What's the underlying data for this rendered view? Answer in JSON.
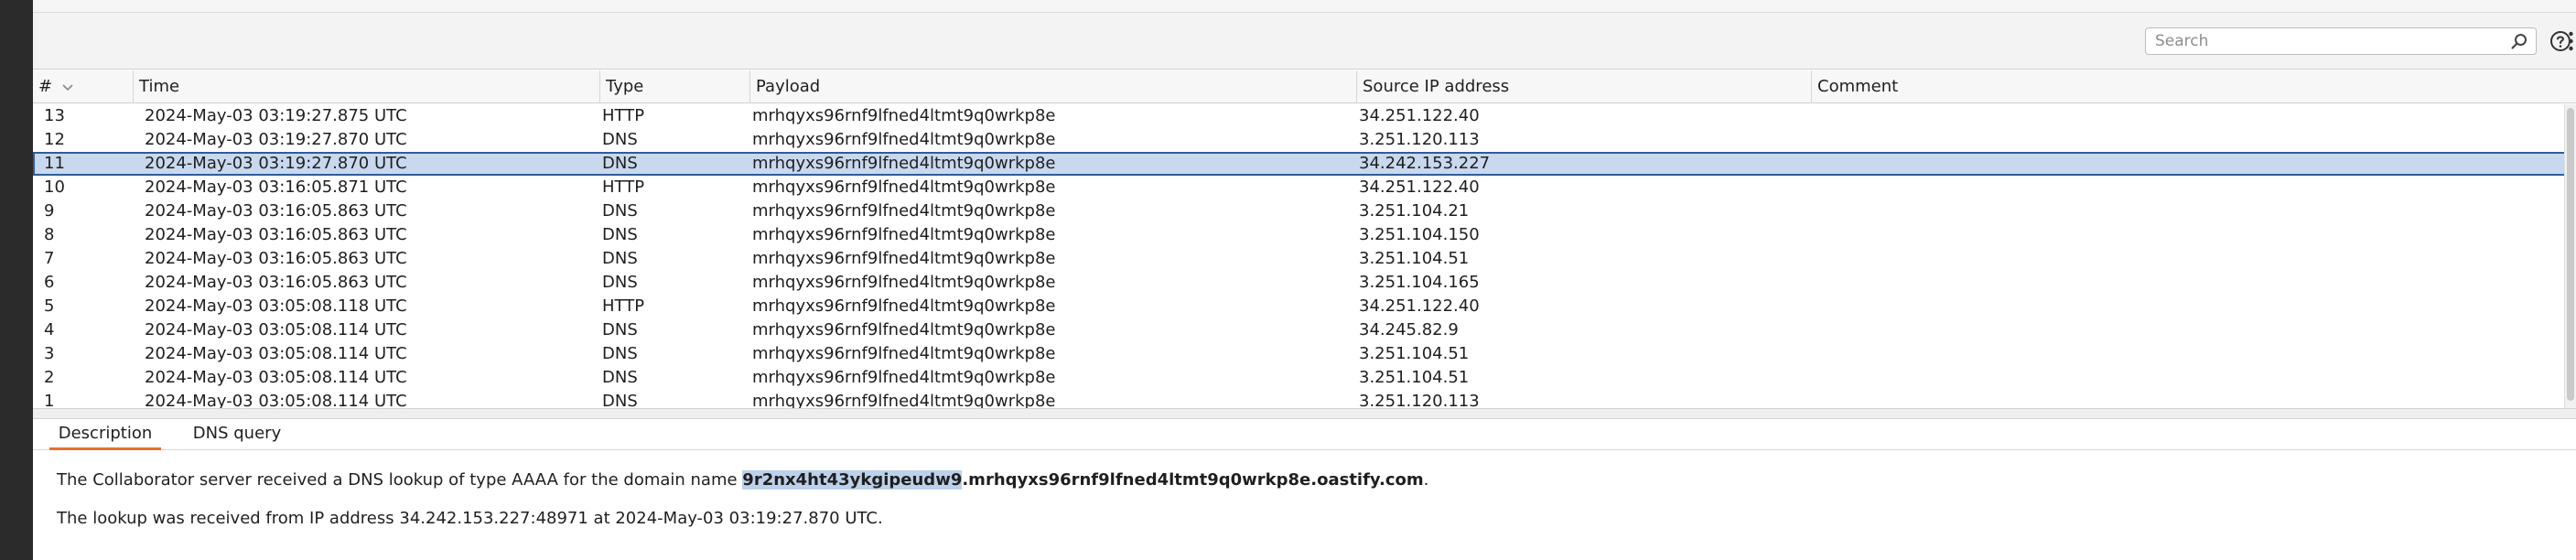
{
  "toolbar": {
    "search_placeholder": "Search",
    "search_icon": "magnifier",
    "help_icon": "question-circle",
    "more_icon": "vertical-ellipsis"
  },
  "table": {
    "columns": {
      "num": "#",
      "time": "Time",
      "type": "Type",
      "payload": "Payload",
      "source_ip": "Source IP address",
      "comment": "Comment"
    },
    "selected_index": 2,
    "rows": [
      {
        "num": "13",
        "time": "2024-May-03 03:19:27.875 UTC",
        "type": "HTTP",
        "payload": "mrhqyxs96rnf9lfned4ltmt9q0wrkp8e",
        "ip": "34.251.122.40",
        "comment": ""
      },
      {
        "num": "12",
        "time": "2024-May-03 03:19:27.870 UTC",
        "type": "DNS",
        "payload": "mrhqyxs96rnf9lfned4ltmt9q0wrkp8e",
        "ip": "3.251.120.113",
        "comment": ""
      },
      {
        "num": "11",
        "time": "2024-May-03 03:19:27.870 UTC",
        "type": "DNS",
        "payload": "mrhqyxs96rnf9lfned4ltmt9q0wrkp8e",
        "ip": "34.242.153.227",
        "comment": ""
      },
      {
        "num": "10",
        "time": "2024-May-03 03:16:05.871 UTC",
        "type": "HTTP",
        "payload": "mrhqyxs96rnf9lfned4ltmt9q0wrkp8e",
        "ip": "34.251.122.40",
        "comment": ""
      },
      {
        "num": "9",
        "time": "2024-May-03 03:16:05.863 UTC",
        "type": "DNS",
        "payload": "mrhqyxs96rnf9lfned4ltmt9q0wrkp8e",
        "ip": "3.251.104.21",
        "comment": ""
      },
      {
        "num": "8",
        "time": "2024-May-03 03:16:05.863 UTC",
        "type": "DNS",
        "payload": "mrhqyxs96rnf9lfned4ltmt9q0wrkp8e",
        "ip": "3.251.104.150",
        "comment": ""
      },
      {
        "num": "7",
        "time": "2024-May-03 03:16:05.863 UTC",
        "type": "DNS",
        "payload": "mrhqyxs96rnf9lfned4ltmt9q0wrkp8e",
        "ip": "3.251.104.51",
        "comment": ""
      },
      {
        "num": "6",
        "time": "2024-May-03 03:16:05.863 UTC",
        "type": "DNS",
        "payload": "mrhqyxs96rnf9lfned4ltmt9q0wrkp8e",
        "ip": "3.251.104.165",
        "comment": ""
      },
      {
        "num": "5",
        "time": "2024-May-03 03:05:08.118 UTC",
        "type": "HTTP",
        "payload": "mrhqyxs96rnf9lfned4ltmt9q0wrkp8e",
        "ip": "34.251.122.40",
        "comment": ""
      },
      {
        "num": "4",
        "time": "2024-May-03 03:05:08.114 UTC",
        "type": "DNS",
        "payload": "mrhqyxs96rnf9lfned4ltmt9q0wrkp8e",
        "ip": "34.245.82.9",
        "comment": ""
      },
      {
        "num": "3",
        "time": "2024-May-03 03:05:08.114 UTC",
        "type": "DNS",
        "payload": "mrhqyxs96rnf9lfned4ltmt9q0wrkp8e",
        "ip": "3.251.104.51",
        "comment": ""
      },
      {
        "num": "2",
        "time": "2024-May-03 03:05:08.114 UTC",
        "type": "DNS",
        "payload": "mrhqyxs96rnf9lfned4ltmt9q0wrkp8e",
        "ip": "3.251.104.51",
        "comment": ""
      },
      {
        "num": "1",
        "time": "2024-May-03 03:05:08.114 UTC",
        "type": "DNS",
        "payload": "mrhqyxs96rnf9lfned4ltmt9q0wrkp8e",
        "ip": "3.251.120.113",
        "comment": ""
      }
    ]
  },
  "detail": {
    "tabs": [
      "Description",
      "DNS query"
    ],
    "active_tab": 0,
    "line1_prefix": "The Collaborator server received a DNS lookup of type AAAA for the domain name ",
    "line1_highlight": "9r2nx4ht43ykgipeudw9",
    "line1_domain": ".mrhqyxs96rnf9lfned4ltmt9q0wrkp8e.oastify.com",
    "line1_suffix": ".",
    "line2": "The lookup was received from IP address 34.242.153.227:48971 at 2024-May-03 03:19:27.870 UTC."
  },
  "colors": {
    "selection_bg": "#c8d8ee",
    "selection_border": "#2f5d9b",
    "active_tab_accent": "#e8702a",
    "highlight_bg": "#bcd1ea"
  }
}
